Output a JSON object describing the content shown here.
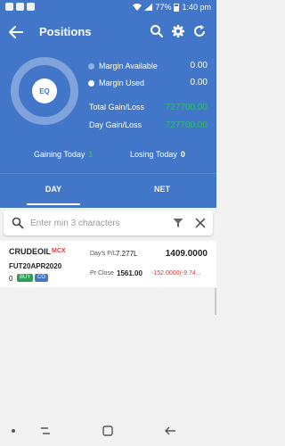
{
  "status_bar": {
    "battery": "77%",
    "time": "1:40 pm"
  },
  "app_bar": {
    "title": "Positions"
  },
  "summary": {
    "chart_label": "EQ",
    "margin_available_label": "Margin Available",
    "margin_available_value": "0.00",
    "margin_used_label": "Margin Used",
    "margin_used_value": "0.00",
    "total_gl_label": "Total Gain/Loss",
    "total_gl_value": "727700.00",
    "day_gl_label": "Day Gain/Loss",
    "day_gl_value": "727700.00",
    "gaining_today_label": "Gaining Today",
    "gaining_today_value": "1",
    "losing_today_label": "Losing Today",
    "losing_today_value": "0",
    "colors": {
      "available_dot": "#8fb0e3",
      "used_dot": "#ffffff",
      "gain": "#2ebd6b"
    }
  },
  "tabs": [
    {
      "label": "DAY",
      "active": true
    },
    {
      "label": "NET",
      "active": false
    }
  ],
  "search": {
    "placeholder": "Enter min 3 characters",
    "value": ""
  },
  "positions": [
    {
      "symbol": "CRUDEOIL",
      "exchange": "MCX",
      "expiry": "FUT20APR2020",
      "qty": "0",
      "side": "BUY",
      "product": "CO",
      "days_pl_label": "Day's P/L",
      "days_pl_value": "7.277L",
      "ltp": "1409.0000",
      "prev_close_label": "Pr Close",
      "prev_close_value": "1561.00",
      "change": "-152.0000(-9.74..."
    }
  ]
}
